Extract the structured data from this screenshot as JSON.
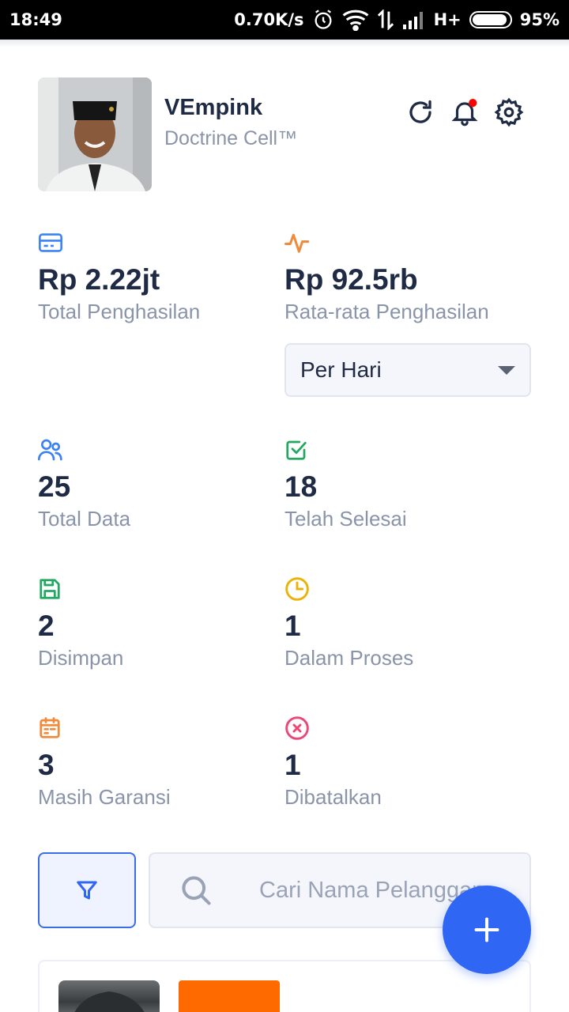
{
  "statusbar": {
    "time": "18:49",
    "speed": "0.70K/s",
    "network": "H+",
    "battery": "95%",
    "battery_level": 0.95
  },
  "profile": {
    "name": "VEmpink",
    "company": "Doctrine Cell™"
  },
  "stats": {
    "total_income": {
      "value": "Rp 2.22jt",
      "label": "Total Penghasilan",
      "icon": "credit-card-icon",
      "color": "#3b82f6"
    },
    "avg_income": {
      "value": "Rp 92.5rb",
      "label": "Rata-rata Penghasilan",
      "icon": "activity-icon",
      "color": "#f08a3c"
    },
    "total_data": {
      "value": "25",
      "label": "Total Data",
      "icon": "users-icon",
      "color": "#3b82f6"
    },
    "completed": {
      "value": "18",
      "label": "Telah Selesai",
      "icon": "check-square-icon",
      "color": "#22a861"
    },
    "saved": {
      "value": "2",
      "label": "Disimpan",
      "icon": "save-icon",
      "color": "#22a861"
    },
    "in_process": {
      "value": "1",
      "label": "Dalam Proses",
      "icon": "clock-icon",
      "color": "#eab308"
    },
    "warranty": {
      "value": "3",
      "label": "Masih Garansi",
      "icon": "calendar-icon",
      "color": "#f08a3c"
    },
    "cancelled": {
      "value": "1",
      "label": "Dibatalkan",
      "icon": "x-circle-icon",
      "color": "#ec4877"
    }
  },
  "period_select": {
    "selected": "Per Hari"
  },
  "search": {
    "placeholder": "Cari Nama Pelanggan"
  },
  "colors": {
    "primary": "#2f66f4",
    "notification_dot": "#ff0000",
    "text": "#1f2a44",
    "muted": "#8a94a8"
  }
}
